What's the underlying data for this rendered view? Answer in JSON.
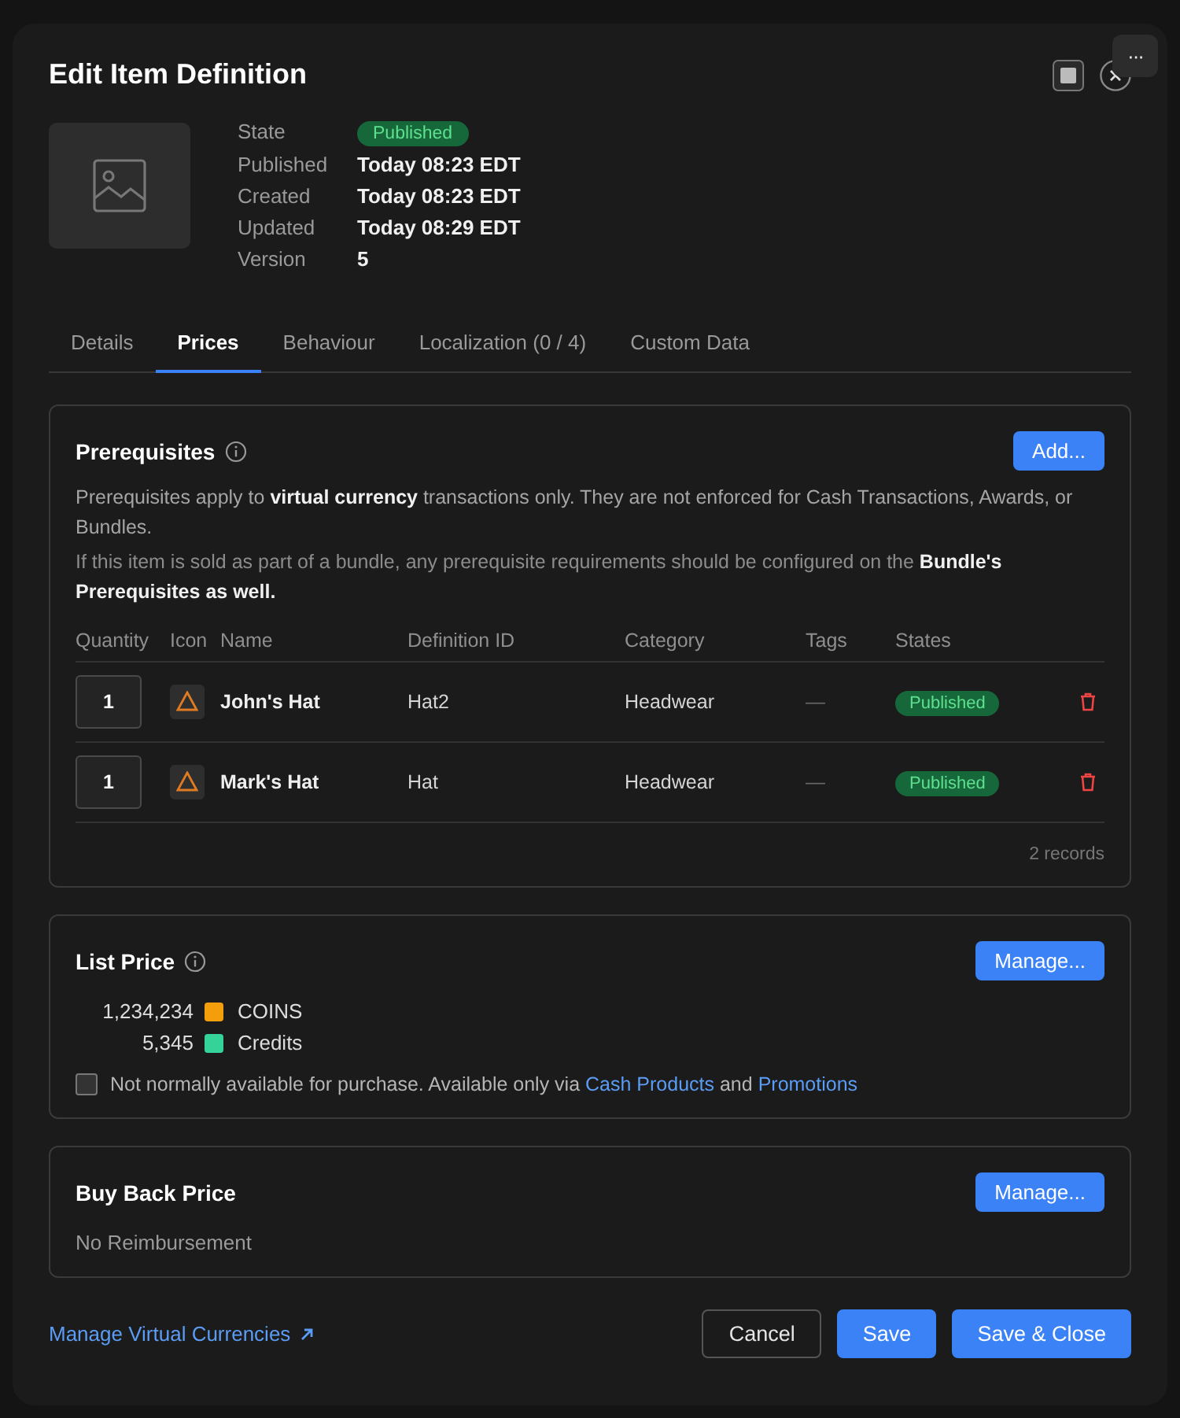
{
  "window": {
    "title": "Edit Item Definition",
    "more_button": "···"
  },
  "meta": [
    {
      "label": "State",
      "value": "Published",
      "kind": "badge"
    },
    {
      "label": "Published",
      "value": "Today 08:23 EDT",
      "kind": "text"
    },
    {
      "label": "Created",
      "value": "Today 08:23 EDT",
      "kind": "text"
    },
    {
      "label": "Updated",
      "value": "Today 08:29 EDT",
      "kind": "text"
    },
    {
      "label": "Version",
      "value": "5",
      "kind": "text"
    }
  ],
  "tabs": [
    {
      "label": "Details",
      "selected": false
    },
    {
      "label": "Prices",
      "selected": true
    },
    {
      "label": "Behaviour",
      "selected": false
    },
    {
      "label": "Localization (0 / 4)",
      "selected": false
    },
    {
      "label": "Custom Data",
      "selected": false
    }
  ],
  "prerequisites": {
    "title": "Prerequisites",
    "add_button": "Add...",
    "note_1": "Prerequisites apply to **virtual currency** transactions only. They are not enforced for Cash Transactions, Awards, or Bundles.",
    "note_2": "If this item is sold as part of a bundle, any prerequisite requirements should be configured on the **Bundle's Prerequisites** **as well.**",
    "columns": [
      "Quantity",
      "Icon",
      "Name",
      "Definition ID",
      "Category",
      "Tags",
      "States"
    ],
    "rows": [
      {
        "quantity": "1",
        "name": "John's Hat",
        "definition_id": "Hat2",
        "category": "Headwear",
        "tags": "—",
        "state": "Published"
      },
      {
        "quantity": "1",
        "name": "Mark's Hat",
        "definition_id": "Hat",
        "category": "Headwear",
        "tags": "—",
        "state": "Published"
      }
    ],
    "record_count": "2 records"
  },
  "list_price": {
    "title": "List Price",
    "manage_button": "Manage...",
    "prices": [
      {
        "amount": "1,234,234",
        "currency": "COINS",
        "color": "#f59e0b"
      },
      {
        "amount": "5,345",
        "currency": "Credits",
        "color": "#34d399"
      }
    ],
    "availability": {
      "checked": false,
      "text": "Not normally available for purchase. Available only via",
      "link_1": "Cash Products",
      "joiner": "and",
      "link_2": "Promotions"
    }
  },
  "buy_back_price": {
    "title": "Buy Back Price",
    "manage_button": "Manage...",
    "value": "No Reimbursement"
  },
  "footer": {
    "link": "Manage Virtual Currencies",
    "buttons": [
      {
        "label": "Cancel",
        "kind": "secondary"
      },
      {
        "label": "Save",
        "kind": "primary"
      },
      {
        "label": "Save & Close",
        "kind": "primary"
      }
    ]
  }
}
